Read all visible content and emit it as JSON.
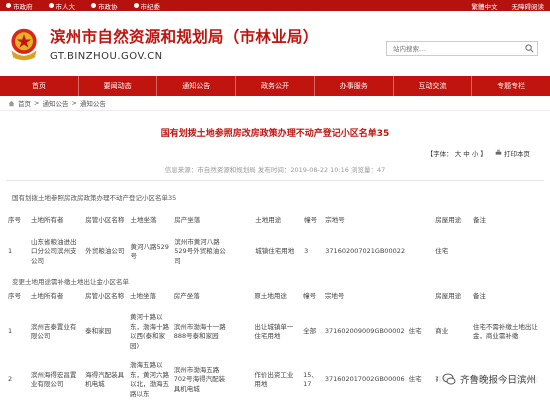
{
  "topbar": {
    "links": [
      "市政府",
      "市人大",
      "市政协",
      "市纪委"
    ],
    "right": [
      "繁體中文",
      "无障碍阅读"
    ]
  },
  "header": {
    "title": "滨州市自然资源和规划局（市林业局）",
    "subtitle": "GT.BINZHOU.GOV.CN",
    "search_placeholder": "站内搜索..."
  },
  "nav": [
    "首页",
    "要闻动态",
    "通知公告",
    "政务公开",
    "办事服务",
    "互动交流",
    "专题专栏"
  ],
  "breadcrumb": [
    "首页",
    "通知公告",
    "通知公告"
  ],
  "article": {
    "title": "国有划拨土地参照房改房政策办理不动产登记小区名单35",
    "font_label": "【字体：",
    "font_sizes": [
      "大",
      "中",
      "小"
    ],
    "font_close": "】",
    "print": "打印本页",
    "meta": "信息来源：市自然资源和规划局  发布时间：2019-08-22 10:16  浏览量：47",
    "section1": "国有划拨土地参照房改房政策办理不动产登记小区名单35",
    "section2": "变更土地用途需补缴土地出让金小区名单"
  },
  "table1": {
    "headers": [
      "序号",
      "土地所有者",
      "房管小区名称",
      "土地坐落",
      "房产坐落",
      "",
      "土地用途",
      "幢号",
      "宗地号",
      "",
      "房屋用途",
      "备注"
    ],
    "rows": [
      [
        "1",
        "山东省粮油进出口分公司滨州支公司",
        "外贸粮油公司",
        "黄河八路529号",
        "滨州市黄河八路529号外贸粮油公司",
        "",
        "城镇住宅用地",
        "3",
        "371602007021GB00022",
        "",
        "住宅",
        ""
      ]
    ]
  },
  "table2": {
    "headers": [
      "序号",
      "土地所有者",
      "房管小区名称",
      "土地坐落",
      "房产坐落",
      "",
      "原土地用途",
      "幢号",
      "宗地号",
      "",
      "房屋用途",
      "备注"
    ],
    "rows": [
      [
        "1",
        "滨州吉泰置业有限公司",
        "泰和家园",
        "黄河十路以东，渤海十路以西(泰和家园)",
        "滨州市渤海十一路888号泰和家园",
        "",
        "出让城镇单一住宅用地",
        "全部",
        "371602009009GB00002",
        "住宅",
        "商业",
        "住宅不需补缴土地出让金，商业需补缴"
      ],
      [
        "2",
        "滨州海得宏昌置业有限公司",
        "海得汽配装具机电城",
        "渤海五路以东，黄河六路以北，渤海五路以东",
        "滨州市渤海五路702号海得汽配装具机电城",
        "",
        "作价出资工业用地",
        "15、17",
        "371602017002GB00006",
        "住宅",
        "商业",
        "单位已补缴土地出让金"
      ]
    ]
  },
  "watermark": "齐鲁晚报今日滨州",
  "colors": {
    "brand_red": "#c0150f",
    "topbar_red": "#b5110d"
  }
}
